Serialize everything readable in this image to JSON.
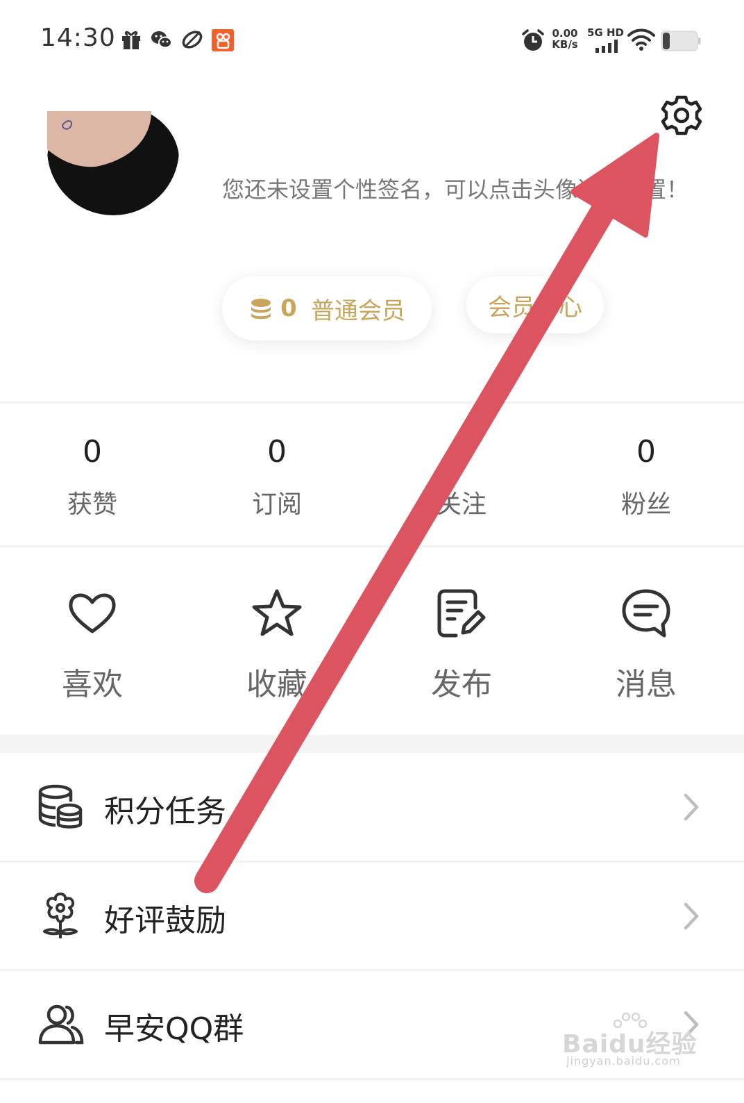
{
  "status_bar": {
    "time": "14:30",
    "net_speed_value": "0.00",
    "net_speed_unit": "KB/s",
    "network_label": "5G HD",
    "icons": [
      "gift-icon",
      "wechat-icon",
      "leaf-icon",
      "app-icon",
      "alarm-icon",
      "signal-icon",
      "wifi-icon",
      "battery-icon"
    ]
  },
  "profile": {
    "signature": "您还未设置个性签名，可以点击头像进行设置！",
    "coins": "0",
    "member_level": "普通会员",
    "member_center": "会员中心"
  },
  "stats": [
    {
      "value": "0",
      "label": "获赞"
    },
    {
      "value": "0",
      "label": "订阅"
    },
    {
      "value": "",
      "label": "关注"
    },
    {
      "value": "0",
      "label": "粉丝"
    }
  ],
  "actions": [
    {
      "label": "喜欢",
      "icon": "heart-icon"
    },
    {
      "label": "收藏",
      "icon": "star-icon"
    },
    {
      "label": "发布",
      "icon": "edit-icon"
    },
    {
      "label": "消息",
      "icon": "message-icon"
    }
  ],
  "menu": [
    {
      "label": "积分任务",
      "icon": "coins-icon"
    },
    {
      "label": "好评鼓励",
      "icon": "flower-icon"
    },
    {
      "label": "早安QQ群",
      "icon": "group-icon"
    }
  ],
  "watermark": {
    "brand": "Baidu经验",
    "url": "jingyan.baidu.com"
  },
  "colors": {
    "accent_gold": "#c8a55a",
    "arrow_red": "#dc5460"
  }
}
